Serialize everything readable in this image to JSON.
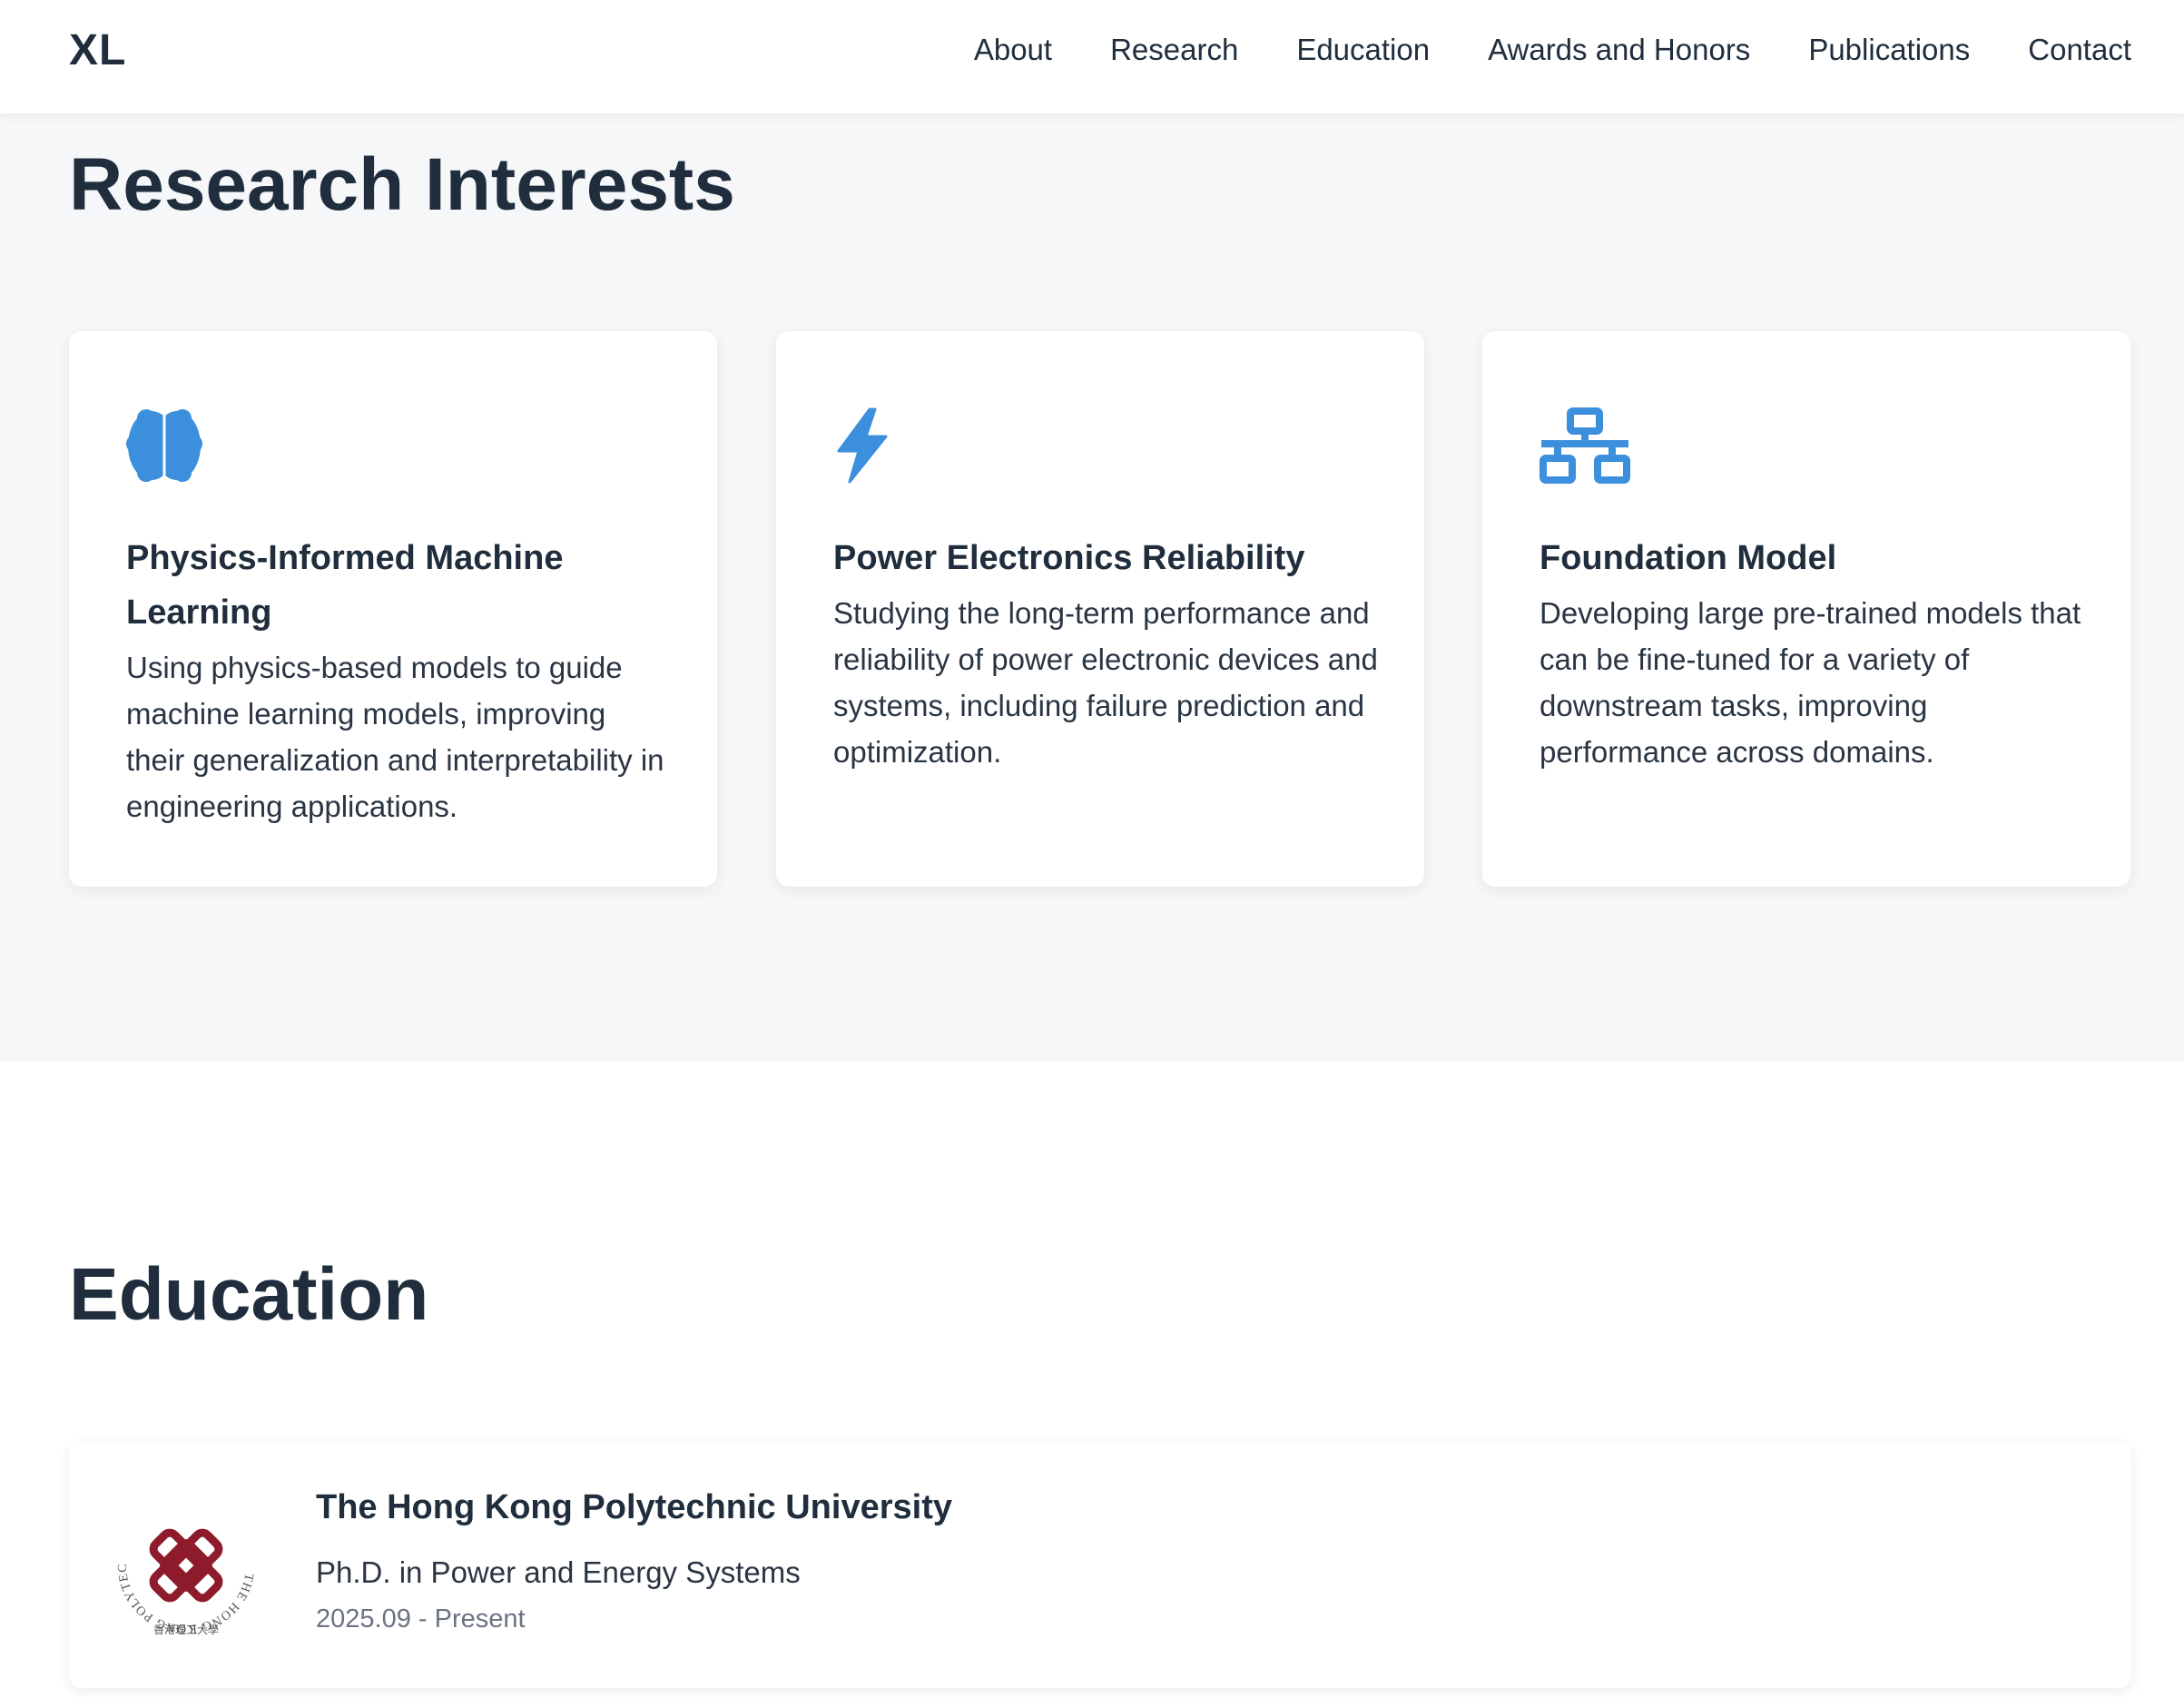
{
  "nav": {
    "logo": "XL",
    "links": [
      "About",
      "Research",
      "Education",
      "Awards and Honors",
      "Publications",
      "Contact"
    ]
  },
  "research": {
    "title": "Research Interests",
    "cards": [
      {
        "icon": "brain-icon",
        "title": "Physics-Informed Machine Learning",
        "description": "Using physics-based models to guide machine learning models, improving their generalization and interpretability in engineering applications."
      },
      {
        "icon": "lightning-bolt-icon",
        "title": "Power Electronics Reliability",
        "description": "Studying the long-term performance and reliability of power electronic devices and systems, including failure prediction and optimization."
      },
      {
        "icon": "network-icon",
        "title": "Foundation Model",
        "description": "Developing large pre-trained models that can be fine-tuned for a variety of downstream tasks, improving performance across domains."
      }
    ]
  },
  "education": {
    "title": "Education",
    "entries": [
      {
        "logo": "polyu-logo",
        "logo_ring_text": "THE HONG KONG POLYTECHNIC UNIVERSITY",
        "logo_chinese_text": "香港理工大學",
        "school": "The Hong Kong Polytechnic University",
        "degree": "Ph.D. in Power and Energy Systems",
        "date": "2025.09 - Present"
      }
    ]
  },
  "colors": {
    "accent": "#3b8fdc",
    "text": "#1f2d3d",
    "section_bg": "#f6f7f9",
    "polyu_red": "#8e1b2b"
  }
}
